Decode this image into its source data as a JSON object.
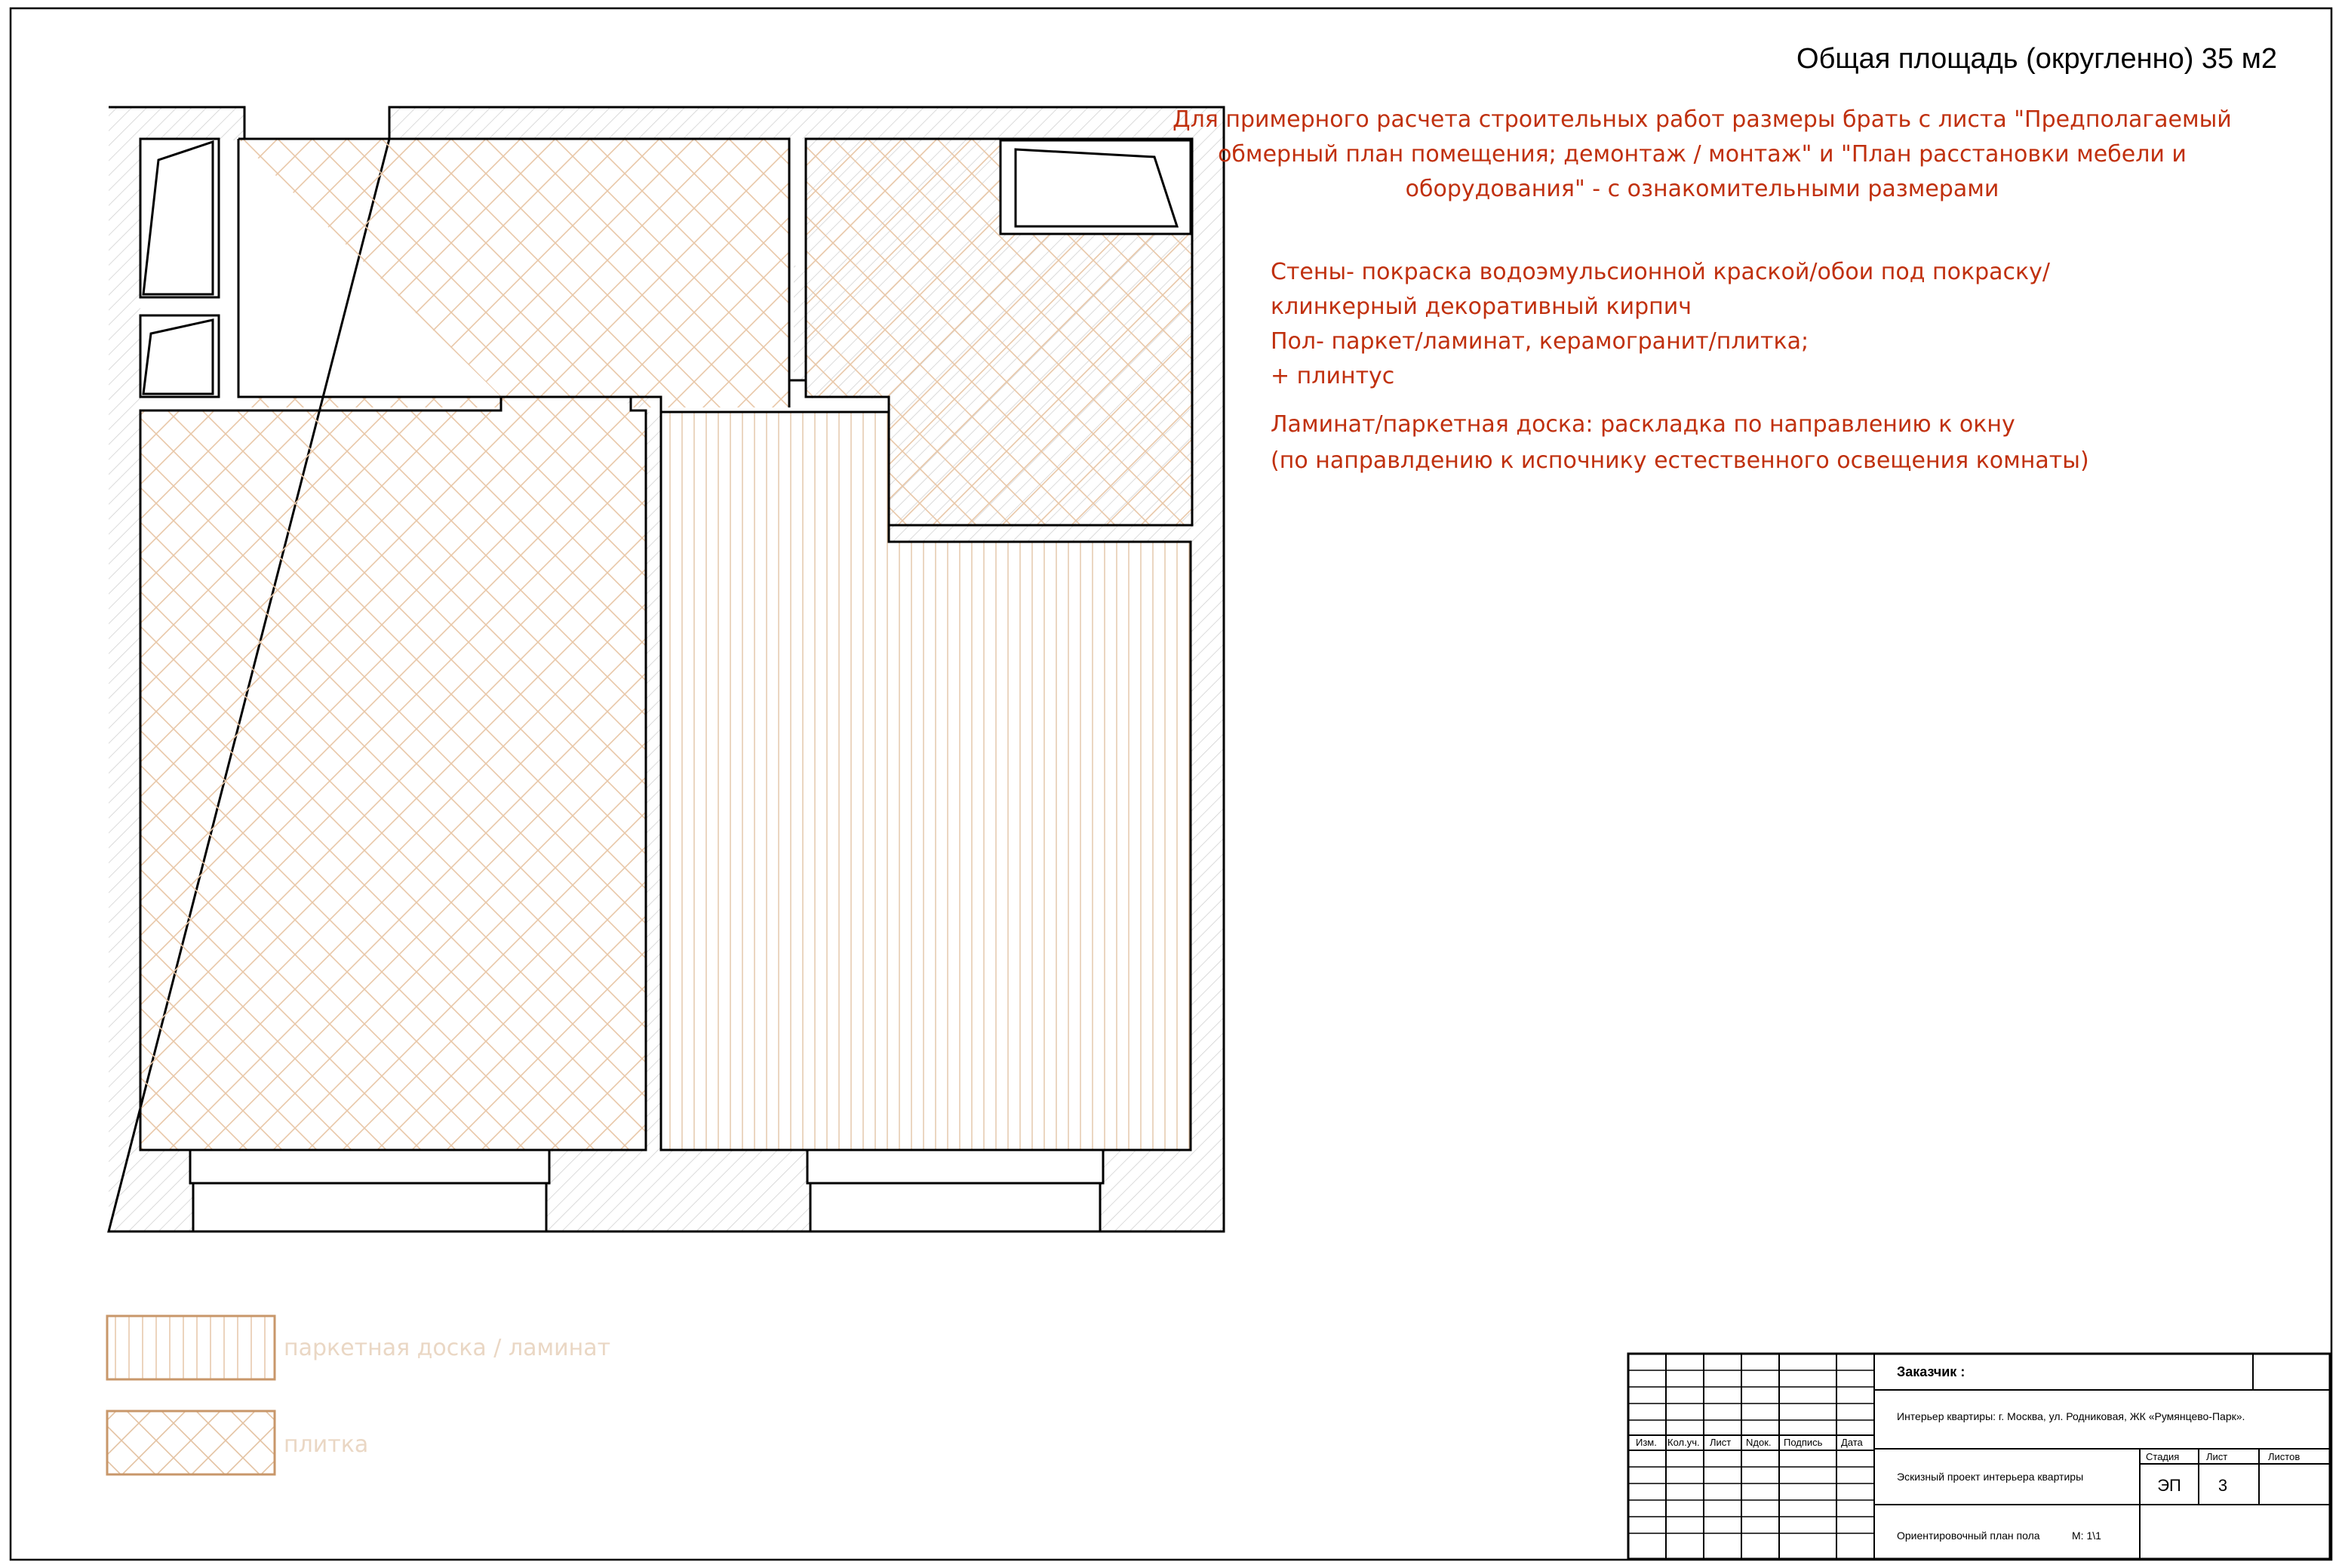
{
  "header": {
    "area_title": "Общая площадь (округленно) 35 м2"
  },
  "notes": {
    "color": "#c0300e",
    "main_lines": [
      "Для примерного расчета строительных работ размеры брать с листа \"Предполагаемый",
      "обмерный план помещения; демонтаж / монтаж\" и \"План расстановки мебели и",
      "оборудования\" - с ознакомительными размерами"
    ],
    "materials_lines": [
      "Стены- покраска водоэмульсионной краской/обои под покраску/",
      "клинкерный декоративный кирпич",
      "Пол- паркет/ламинат, керамогранит/плитка;",
      "+ плинтус"
    ],
    "laminate_lines": [
      "Ламинат/паркетная доска: раскладка по направлению к окну",
      "(по направлдению к испочнику естественного освещения комнаты)"
    ]
  },
  "legend": {
    "color": "#c8976a",
    "items": [
      {
        "pattern": "vertical-lines",
        "label": "паркетная доска / ламинат"
      },
      {
        "pattern": "crosshatch",
        "label": "плитка"
      }
    ]
  },
  "title_block": {
    "customer_label": "Заказчик :",
    "project_description": "Интерьер квартиры: г. Москва, ул. Родниковая, ЖК «Румянцево-Парк».",
    "column_headers": [
      "Изм.",
      "Кол.уч.",
      "Лист",
      "Nдок.",
      "Подпись",
      "Дата"
    ],
    "stage_headers": [
      "Стадия",
      "Лист",
      "Листов"
    ],
    "stage_values": [
      "ЭП",
      "3",
      ""
    ],
    "project_type": "Эскизный проект интерьера квартиры",
    "sheet_name": "Ориентировочный план пола",
    "scale": "М: 1\\1"
  },
  "colors": {
    "hatch_tile": "#e8c7a8",
    "hatch_wall": "#cfcfcf",
    "laminate_lines": "#e2c4a6",
    "note_red": "#c0300e",
    "legend_brown": "#c8976a"
  }
}
